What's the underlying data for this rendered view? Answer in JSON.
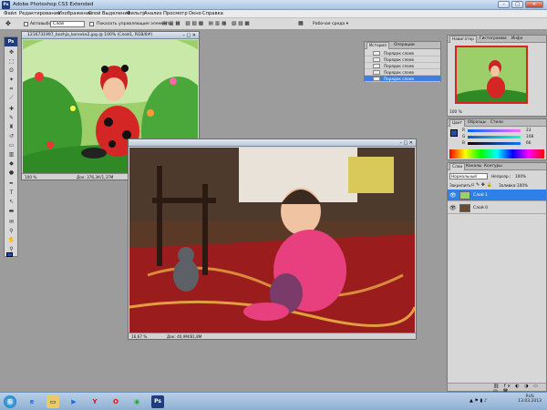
{
  "app": {
    "title": "Adobe Photoshop CS3 Extended",
    "logo": "Ps"
  },
  "colors": {
    "selection": "#2d80e8",
    "workspace": "#9c9c9c",
    "foreground": "#1f4fa0"
  },
  "menu": [
    "Файл",
    "Редактирование",
    "Изображение",
    "Слой",
    "Выделение",
    "Фильтр",
    "Анализ",
    "Просмотр",
    "Окно",
    "Справка"
  ],
  "options": {
    "autoselect_label": "Автовыбор:",
    "autoselect_value": "Слой",
    "show_controls": "Показать управляющие элементы",
    "workspace_button": "Рабочая среда ▾"
  },
  "doc1": {
    "title": "1216731997_bozhja_korovka2.jpg @ 100% (Слой1, RGB/8#)",
    "zoom": "100 %",
    "info": "Док: 376,3К/1,37М"
  },
  "doc2": {
    "zoom": "16,67 %",
    "info": "Док: 40,9М/81,8М"
  },
  "history": {
    "tabs": [
      "История",
      "Операции"
    ],
    "items": [
      "Порядок слоев",
      "Порядок слоев",
      "Порядок слоев",
      "Порядок слоев",
      "Порядок слоев"
    ]
  },
  "navigator": {
    "tabs": [
      "Навигатор",
      "Гистограмма",
      "Инфо"
    ],
    "zoom": "100 %"
  },
  "color": {
    "tabs": [
      "Цвет",
      "Образцы",
      "Стили"
    ],
    "channels": [
      {
        "label": "R",
        "value": "23"
      },
      {
        "label": "G",
        "value": "108"
      },
      {
        "label": "B",
        "value": "66"
      }
    ]
  },
  "layers": {
    "tabs": [
      "Слои",
      "Каналы",
      "Контуры"
    ],
    "mode": "Нормальный",
    "opacity_label": "Непрозр.:",
    "opacity": "100%",
    "lock_label": "Закрепить:",
    "fill_label": "Заливка:",
    "fill": "100%",
    "items": [
      {
        "name": "Слой 1",
        "selected": true
      },
      {
        "name": "Слой 0",
        "selected": false
      }
    ]
  },
  "taskbar": {
    "icons": [
      "start-orb",
      "internet-explorer",
      "explorer",
      "media-player",
      "yandex-browser",
      "opera",
      "chrome",
      "photoshop"
    ],
    "lang": "RUS",
    "time": "13.03.2013"
  }
}
